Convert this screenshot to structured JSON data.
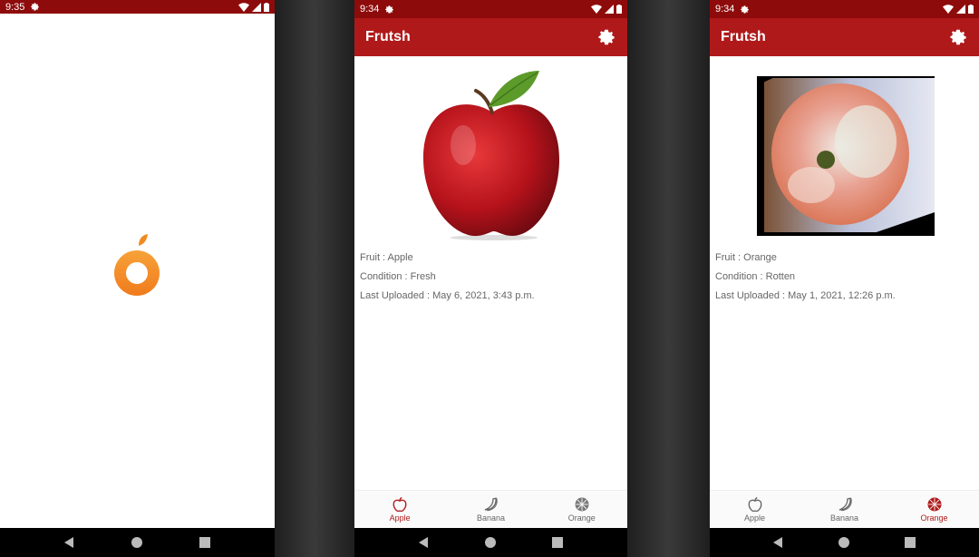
{
  "colors": {
    "status_bar": "#8e0b0b",
    "app_bar": "#b0191a",
    "accent": "#b0191a",
    "background_dark": "#2b2b2b",
    "splash_logo": "#f5891e"
  },
  "splash": {
    "status_time": "9:35",
    "logo_icon": "orange-fruit-logo"
  },
  "apple_screen": {
    "status_time": "9:34",
    "app_title": "Frutsh",
    "image_icon": "red-apple-photo",
    "fruit_line": "Fruit : Apple",
    "condition_line": "Condition : Fresh",
    "uploaded_line": "Last Uploaded : May 6, 2021, 3:43 p.m.",
    "nav": [
      {
        "label": "Apple",
        "icon": "apple-icon",
        "active": true
      },
      {
        "label": "Banana",
        "icon": "banana-icon",
        "active": false
      },
      {
        "label": "Orange",
        "icon": "orange-icon",
        "active": false
      }
    ]
  },
  "orange_screen": {
    "status_time": "9:34",
    "app_title": "Frutsh",
    "image_icon": "rotten-orange-photo",
    "fruit_line": "Fruit : Orange",
    "condition_line": "Condition : Rotten",
    "uploaded_line": "Last Uploaded : May 1, 2021, 12:26 p.m.",
    "nav": [
      {
        "label": "Apple",
        "icon": "apple-icon",
        "active": false
      },
      {
        "label": "Banana",
        "icon": "banana-icon",
        "active": false
      },
      {
        "label": "Orange",
        "icon": "orange-icon",
        "active": true
      }
    ]
  }
}
